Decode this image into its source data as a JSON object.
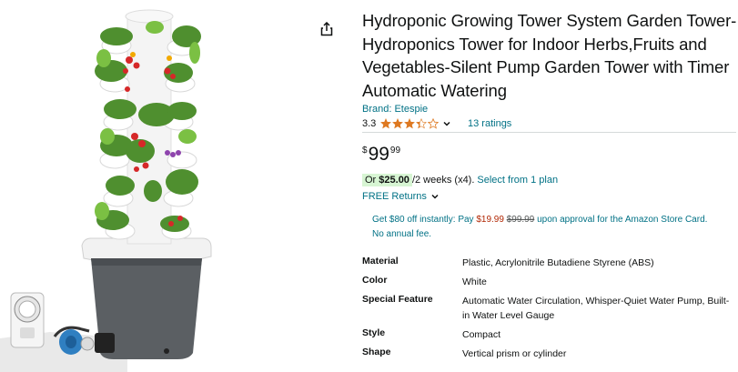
{
  "product": {
    "title": "Hydroponic Growing Tower System Garden Tower-Hydroponics Tower for Indoor Herbs,Fruits and Vegetables-Silent Pump Garden Tower with Timer Automatic Watering",
    "brand": "Brand: Etespie",
    "rating": "3.3",
    "rating_value": 3.3,
    "rating_max": 5,
    "ratings_count": "13 ratings"
  },
  "price": {
    "symbol": "$",
    "whole": "99",
    "fraction": "99"
  },
  "plan": {
    "prefix": "Or ",
    "amount": "$25.00",
    "terms": " /2 weeks (x4).",
    "link": "Select from 1 plan"
  },
  "returns": {
    "label": "FREE Returns"
  },
  "promo": {
    "part1": "Get $80 off instantly: Pay ",
    "new_price": "$19.99",
    "old_price": "$99.99",
    "part2": " upon approval for the Amazon Store Card. No annual fee."
  },
  "specs": [
    {
      "key": "Material",
      "value": "Plastic, Acrylonitrile Butadiene Styrene (ABS)"
    },
    {
      "key": "Color",
      "value": "White"
    },
    {
      "key": "Special Feature",
      "value": "Automatic Water Circulation, Whisper-Quiet Water Pump, Built-in Water Level Gauge"
    },
    {
      "key": "Style",
      "value": "Compact"
    },
    {
      "key": "Shape",
      "value": "Vertical prism or cylinder"
    }
  ],
  "colors": {
    "link": "#007185",
    "star": "#de7921",
    "price_red": "#b12704",
    "plan_bg": "#d7f5d3",
    "text": "#0f1111"
  },
  "icons": {
    "share": "share-icon",
    "chevron": "chevron-down-icon",
    "star": "star-icon"
  }
}
